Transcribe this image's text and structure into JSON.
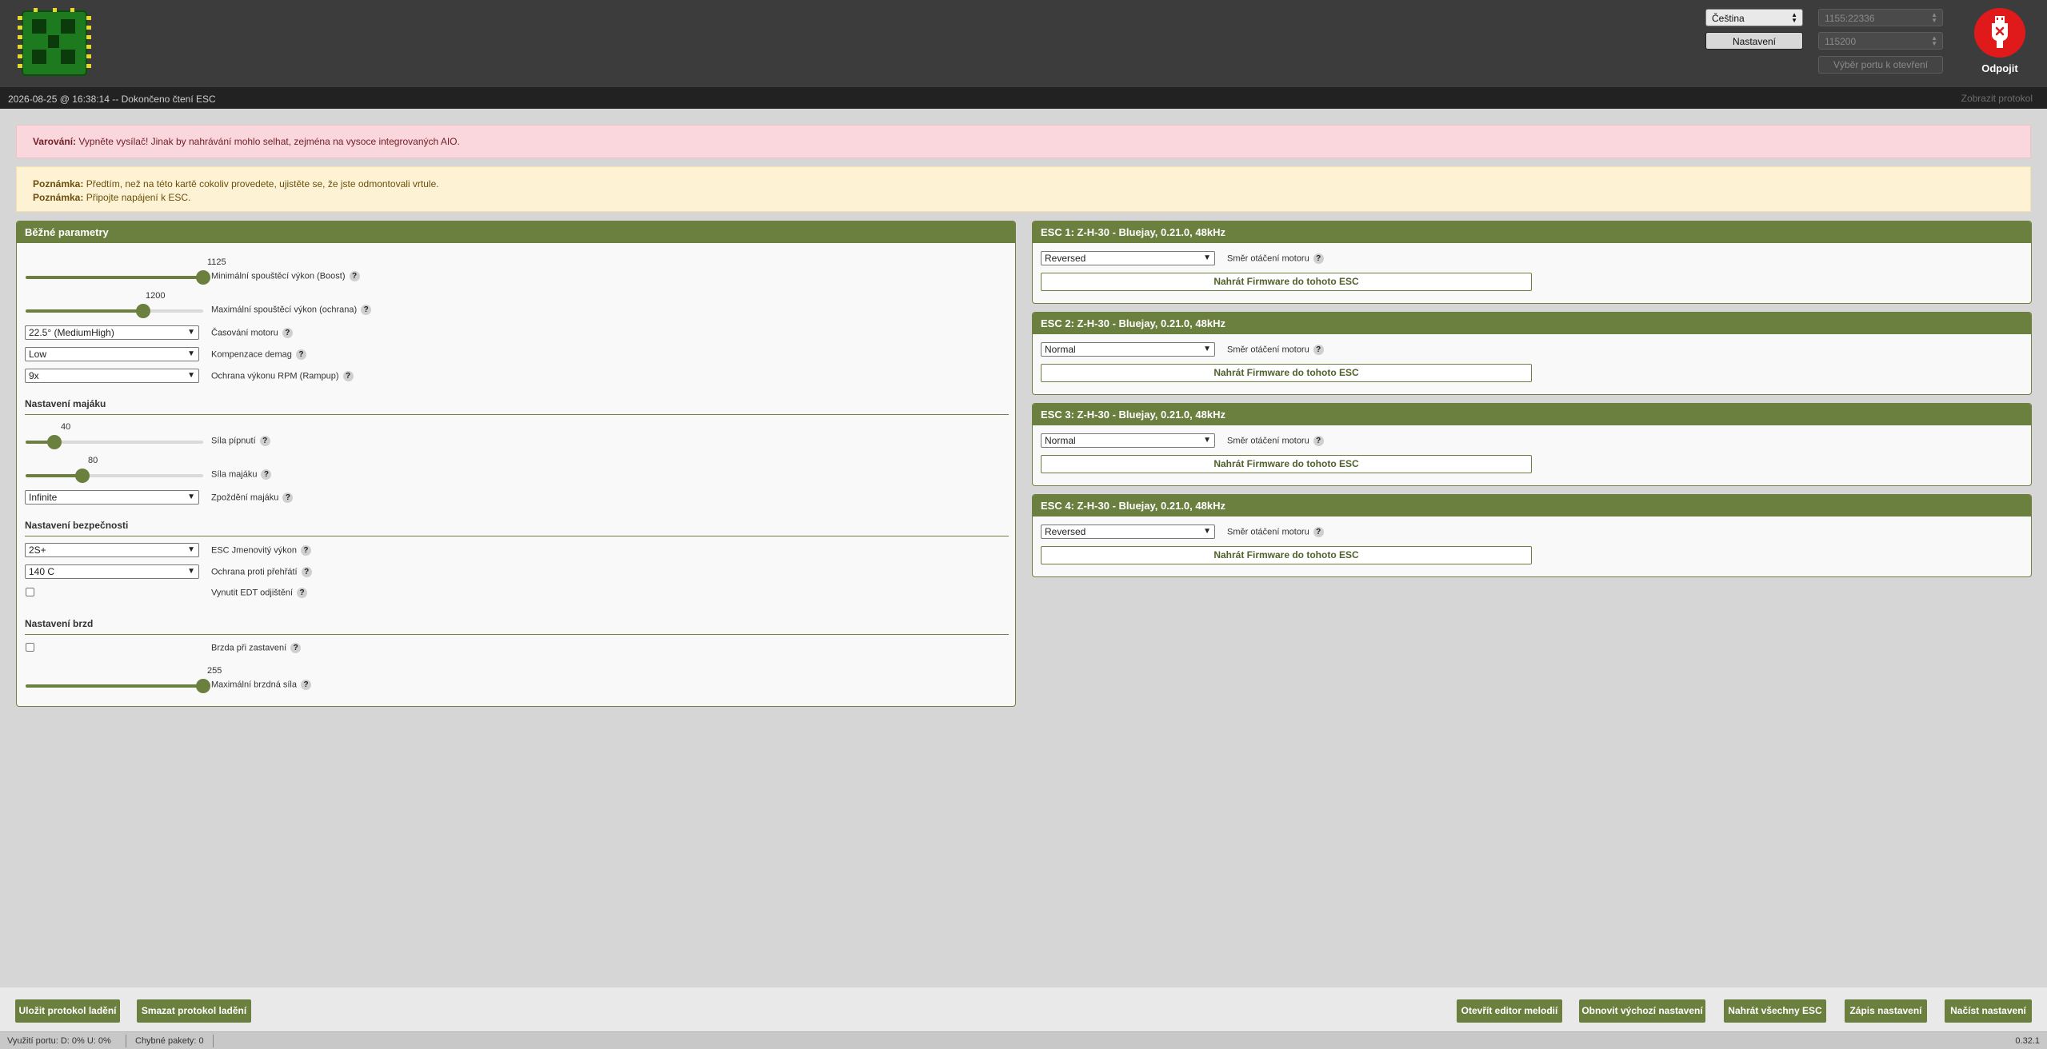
{
  "header": {
    "language": "Čeština",
    "settings_label": "Nastavení",
    "port": "1155:22336",
    "baud": "115200",
    "port_pick_label": "Výběr portu k otevření",
    "disconnect_label": "Odpojit"
  },
  "logbar": {
    "text": "2026-08-25 @ 16:38:14 -- Dokončeno čtení ESC",
    "show_log": "Zobrazit protokol"
  },
  "notes": {
    "warning_prefix": "Varování:",
    "warning_text": " Vypněte vysílač! Jinak by nahrávání mohlo selhat, zejména na vysoce integrovaných AIO.",
    "note_prefix": "Poznámka:",
    "note1_text": " Předtím, než na této kartě cokoliv provedete, ujistěte se, že jste odmontovali vrtule.",
    "note2_text": " Připojte napájení k ESC."
  },
  "common": {
    "title": "Běžné parametry",
    "help": "?",
    "min_startup": {
      "label": "Minimální spouštěcí výkon (Boost)",
      "value": "1125",
      "fraction": 1.0
    },
    "max_startup": {
      "label": "Maximální spouštěcí výkon (ochrana)",
      "value": "1200",
      "fraction": 0.66
    },
    "timing": {
      "label": "Časování motoru",
      "value": "22.5° (MediumHigh)"
    },
    "demag": {
      "label": "Kompenzace demag",
      "value": "Low"
    },
    "rampup": {
      "label": "Ochrana výkonu RPM (Rampup)",
      "value": "9x"
    },
    "beacon_section": "Nastavení majáku",
    "beep_strength": {
      "label": "Síla pípnutí",
      "value": "40",
      "fraction": 0.16
    },
    "beacon_strength": {
      "label": "Síla majáku",
      "value": "80",
      "fraction": 0.32
    },
    "beacon_delay": {
      "label": "Zpoždění majáku",
      "value": "Infinite"
    },
    "safety_section": "Nastavení bezpečnosti",
    "esc_rating": {
      "label": "ESC Jmenovitý výkon",
      "value": "2S+"
    },
    "temp_protection": {
      "label": "Ochrana proti přehřátí",
      "value": "140 C"
    },
    "force_edt": {
      "label": "Vynutit EDT odjištění",
      "checked": false
    },
    "brake_section": "Nastavení brzd",
    "brake_on_stop": {
      "label": "Brzda při zastavení",
      "checked": false
    },
    "max_brake": {
      "label": "Maximální brzdná síla",
      "value": "255",
      "fraction": 1.0
    }
  },
  "escs": [
    {
      "title": "ESC 1: Z-H-30 - Bluejay, 0.21.0, 48kHz",
      "direction": "Reversed",
      "direction_label": "Směr otáčení motoru",
      "flash_label": "Nahrát Firmware do tohoto ESC"
    },
    {
      "title": "ESC 2: Z-H-30 - Bluejay, 0.21.0, 48kHz",
      "direction": "Normal",
      "direction_label": "Směr otáčení motoru",
      "flash_label": "Nahrát Firmware do tohoto ESC"
    },
    {
      "title": "ESC 3: Z-H-30 - Bluejay, 0.21.0, 48kHz",
      "direction": "Normal",
      "direction_label": "Směr otáčení motoru",
      "flash_label": "Nahrát Firmware do tohoto ESC"
    },
    {
      "title": "ESC 4: Z-H-30 - Bluejay, 0.21.0, 48kHz",
      "direction": "Reversed",
      "direction_label": "Směr otáčení motoru",
      "flash_label": "Nahrát Firmware do tohoto ESC"
    }
  ],
  "bottom": {
    "save_log": "Uložit protokol ladění",
    "clear_log": "Smazat protokol ladění",
    "melody_editor": "Otevřít editor melodií",
    "restore_defaults": "Obnovit výchozí nastavení",
    "flash_all": "Nahrát všechny ESC",
    "write_settings": "Zápis nastavení",
    "read_settings": "Načíst nastavení"
  },
  "status": {
    "port_usage": "Využití portu: D: 0% U: 0%",
    "packet_errors": "Chybné pakety: 0",
    "version": "0.32.1"
  },
  "colors": {
    "accent": "#6b7f3f",
    "header": "#3c3c3c",
    "disconnect": "#e01a1a"
  }
}
